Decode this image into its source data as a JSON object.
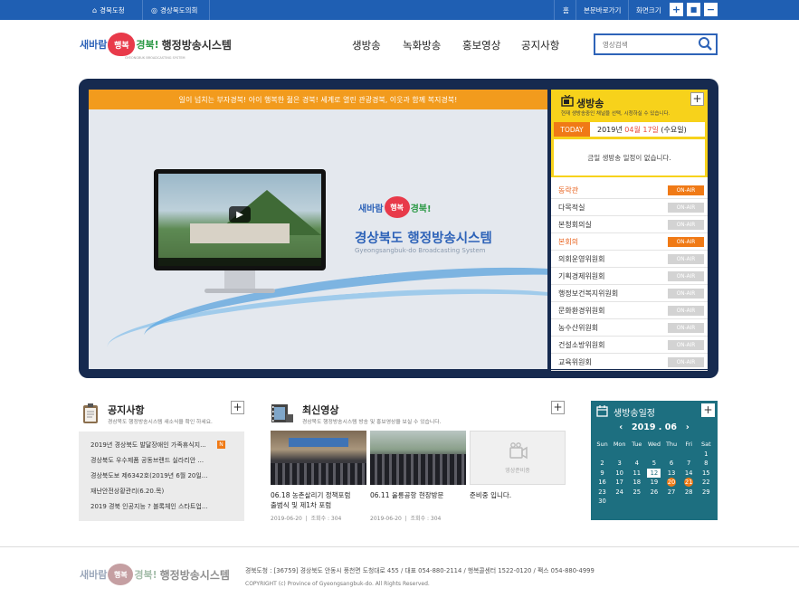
{
  "topbar": {
    "province_link": "경북도청",
    "council_link": "경상북도의회",
    "home_label": "홈",
    "skip_label": "본문바로가기",
    "screen_size_label": "화면크기",
    "zoom_in": "+",
    "zoom_reset": "■",
    "zoom_out": "−"
  },
  "header": {
    "logo_part1": "새바람",
    "logo_heart": "행복",
    "logo_part2": "경북!",
    "logo_part3": "행정방송시스템",
    "logo_sub": "GYEONGBUK BROADCASTING SYSTEM",
    "nav": [
      "생방송",
      "녹화방송",
      "홍보영상",
      "공지사항"
    ],
    "search_placeholder": "영상검색"
  },
  "video": {
    "banner": "일이 넘치는 부자경북! 아이 행복한 젊은 경북! 세계로 열린 관광경북, 이웃과 함께 복지경북!",
    "logo_part1": "새바람",
    "logo_heart": "행복",
    "logo_part2": "경북!",
    "title": "경상북도 행정방송시스템",
    "subtitle": "Gyeongsangbuk-do Broadcasting System"
  },
  "live": {
    "title": "생방송",
    "desc": "현재 생방송중인 채널을 선택, 시청하실 수 있습니다.",
    "more": "+",
    "today_badge": "TODAY",
    "date_prefix": "2019년 ",
    "date_highlight": "04월 17일",
    "date_suffix": " (수요일)",
    "no_schedule": "금일 생방송 일정이 없습니다.",
    "channels": [
      {
        "name": "동락관",
        "status": "ON-AIR",
        "on": true
      },
      {
        "name": "다목적실",
        "status": "ON-AIR",
        "on": false
      },
      {
        "name": "본청회의실",
        "status": "ON-AIR",
        "on": false
      },
      {
        "name": "본회의",
        "status": "ON-AIR",
        "on": true
      },
      {
        "name": "의회운영위원회",
        "status": "ON-AIR",
        "on": false
      },
      {
        "name": "기획경제위원회",
        "status": "ON-AIR",
        "on": false
      },
      {
        "name": "행정보건복지위원회",
        "status": "ON-AIR",
        "on": false
      },
      {
        "name": "문화환경위원회",
        "status": "ON-AIR",
        "on": false
      },
      {
        "name": "농수산위원회",
        "status": "ON-AIR",
        "on": false
      },
      {
        "name": "건설소방위원회",
        "status": "ON-AIR",
        "on": false
      },
      {
        "name": "교육위원회",
        "status": "ON-AIR",
        "on": false
      }
    ]
  },
  "notice": {
    "title": "공지사항",
    "desc": "경상북도 행정방송시스템 새소식을 확인 하세요.",
    "more": "+",
    "new_badge": "N",
    "items": [
      "2019년 경상북도 발달장애인 가족휴식지...",
      "경상북도 우수제품 공동브랜드 실라리안 ...",
      "경상북도보 제6342호(2019년 6월 20일...",
      "재난안전상황관리(6.20.목)",
      "2019 경북 인공지능 ? 블록체인 스타트업..."
    ]
  },
  "videos": {
    "title": "최신영상",
    "desc": "경상북도 행정방송시스템 방송 및 홍보영상을 보실 수 있습니다.",
    "more": "+",
    "preparing_label": "영상준비중",
    "items": [
      {
        "title1": "06.18 농촌살리기 정책포럼",
        "title2": "출범식 및 제1차 포럼",
        "date": "2019-06-20",
        "views": "조회수 : 304"
      },
      {
        "title1": "06.11 울릉공항 현장방문",
        "title2": "",
        "date": "2019-06-20",
        "views": "조회수 : 304"
      },
      {
        "title1": "준비중 입니다.",
        "title2": "",
        "date": "",
        "views": ""
      }
    ]
  },
  "calendar": {
    "title": "생방송일정",
    "more": "+",
    "prev": "‹",
    "next": "›",
    "month_label": "2019 . 06",
    "weekdays": [
      "Sun",
      "Mon",
      "Tue",
      "Wed",
      "Thu",
      "Fri",
      "Sat"
    ],
    "weeks": [
      [
        "",
        "",
        "",
        "",
        "",
        "",
        "1"
      ],
      [
        "2",
        "3",
        "4",
        "5",
        "6",
        "7",
        "8"
      ],
      [
        "9",
        "10",
        "11",
        "12",
        "13",
        "14",
        "15"
      ],
      [
        "16",
        "17",
        "18",
        "19",
        "20",
        "21",
        "22"
      ],
      [
        "23",
        "24",
        "25",
        "26",
        "27",
        "28",
        "29"
      ],
      [
        "30",
        "",
        "",
        "",
        "",
        "",
        ""
      ]
    ],
    "today": "12",
    "event_days": [
      "20",
      "21"
    ]
  },
  "footer": {
    "logo_part1": "새바람",
    "logo_heart": "행복",
    "logo_part2": "경북!",
    "logo_part3": "행정방송시스템",
    "address": "경북도청 : [36759] 경상북도 안동시 풍천면 도청대로 455 / 대표 054-880-2114 / 행복콜센터 1522-0120 / 팩스 054-880-4999",
    "copyright": "COPYRIGHT (c) Province of Gyeongsangbuk-do. All Rights Reserved."
  },
  "colors": {
    "topbar": "#1f5fb3",
    "stage": "#162a4f",
    "live_header": "#f7d21b",
    "onair": "#f07a16",
    "calendar": "#1d6f80"
  }
}
